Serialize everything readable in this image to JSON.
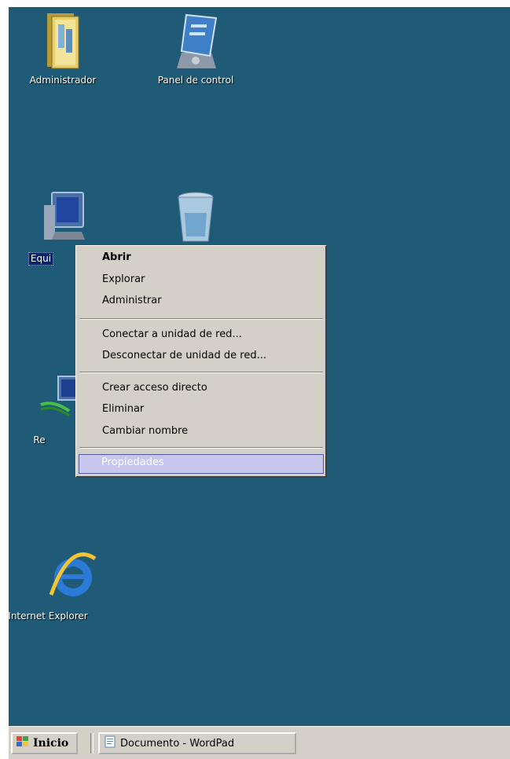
{
  "desktop": {
    "background": "#1f5b76",
    "icons": [
      {
        "label": "Administrador",
        "icon": "user-folder-icon"
      },
      {
        "label": "Panel de control",
        "icon": "control-panel-icon"
      },
      {
        "label": "Equi",
        "icon": "computer-icon"
      },
      {
        "label": "",
        "icon": "recycle-bin-icon"
      },
      {
        "label": "Re",
        "icon": "network-icon"
      },
      {
        "label": "Internet Explorer",
        "icon": "internet-explorer-icon"
      }
    ]
  },
  "context_menu": {
    "items": [
      {
        "label": "Abrir"
      },
      {
        "label": "Explorar"
      },
      {
        "label": "Administrar"
      },
      {
        "label": "Conectar a unidad de red..."
      },
      {
        "label": "Desconectar de unidad de red..."
      },
      {
        "label": "Crear acceso directo"
      },
      {
        "label": "Eliminar"
      },
      {
        "label": "Cambiar nombre"
      },
      {
        "label": "Propiedades"
      }
    ],
    "highlight_color": "#c9c6ee"
  },
  "taskbar": {
    "start_label": "Inicio",
    "tasks": [
      {
        "label": "Documento - WordPad",
        "icon": "wordpad-icon"
      }
    ]
  }
}
